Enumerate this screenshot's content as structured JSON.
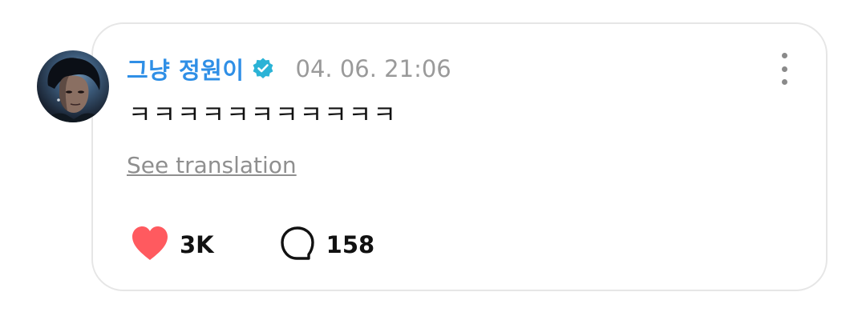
{
  "post": {
    "author": "그냥 정원이",
    "timestamp": "04. 06. 21:06",
    "text": "ㅋㅋㅋㅋㅋㅋㅋㅋㅋㅋㅋ",
    "see_translation": "See translation",
    "likes": "3K",
    "comments": "158"
  },
  "icons": {
    "avatar": "profile-photo",
    "verified": "verified-badge-icon",
    "more": "more-vertical-icon",
    "like": "heart-icon",
    "comment": "comment-bubble-icon"
  },
  "colors": {
    "author": "#2f8fe6",
    "verified": "#2bb3d6",
    "heart": "#ff5a5f",
    "timestamp": "#9a9a9a",
    "card_border": "#e6e6e6"
  }
}
